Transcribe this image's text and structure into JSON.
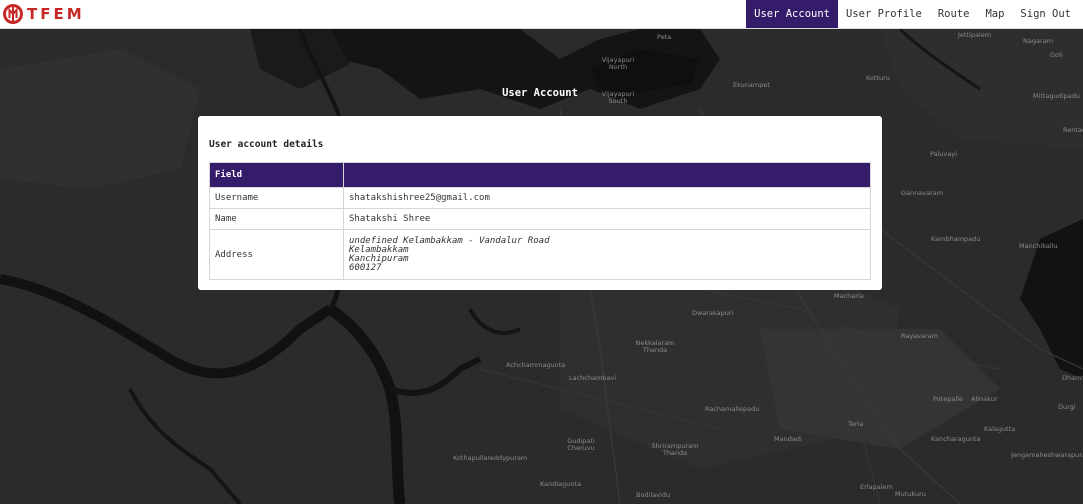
{
  "brand": {
    "name": "TFEM",
    "logo_icon": "tfem-logo-icon",
    "color": "#c62828"
  },
  "nav": {
    "items": [
      {
        "label": "User Account",
        "active": true
      },
      {
        "label": "User Profile",
        "active": false
      },
      {
        "label": "Route",
        "active": false
      },
      {
        "label": "Map",
        "active": false
      },
      {
        "label": "Sign Out",
        "active": false
      }
    ],
    "active_color": "#351c6b"
  },
  "page": {
    "title": "User Account"
  },
  "card": {
    "heading": "User account details",
    "table": {
      "headers": [
        "Field",
        ""
      ],
      "rows": [
        {
          "field": "Username",
          "value": "shatakshishree25@gmail.com"
        },
        {
          "field": "Name",
          "value": "Shatakshi Shree"
        }
      ],
      "address": {
        "field": "Address",
        "lines": [
          "undefined Kelambakkam - Vandalur Road",
          "Kelambakkam",
          "Kanchipuram",
          "600127"
        ]
      }
    }
  },
  "map": {
    "place_labels": [
      "Peta",
      "Vijayapuri North",
      "Vijayapuri South",
      "Ekunampet",
      "Kotturu",
      "Jettipalem",
      "Goli",
      "Mittagudipadu",
      "Rentachintala",
      "Paluvayi",
      "Gannavaram",
      "Kambhampadu",
      "Manchikallu",
      "Macharla",
      "Durgi",
      "Rayavaram",
      "Potepalle",
      "Alinakur",
      "Dwarakapuri",
      "Nekkalaram Thanda",
      "Achchammagunta",
      "Lachchambavi",
      "Rachamallepadu",
      "Mandadi",
      "Teria",
      "Gudipati Cheruvu",
      "Shrirampuram Thanda",
      "Kothapullareddypuram",
      "Kancharagunta",
      "Kalagutta",
      "Kandiagunta",
      "Bodilavidu",
      "Erlapalem",
      "Jengamaheshwarapuram",
      "Mutukuru",
      "Nagaram",
      "Dharmavaram"
    ]
  }
}
